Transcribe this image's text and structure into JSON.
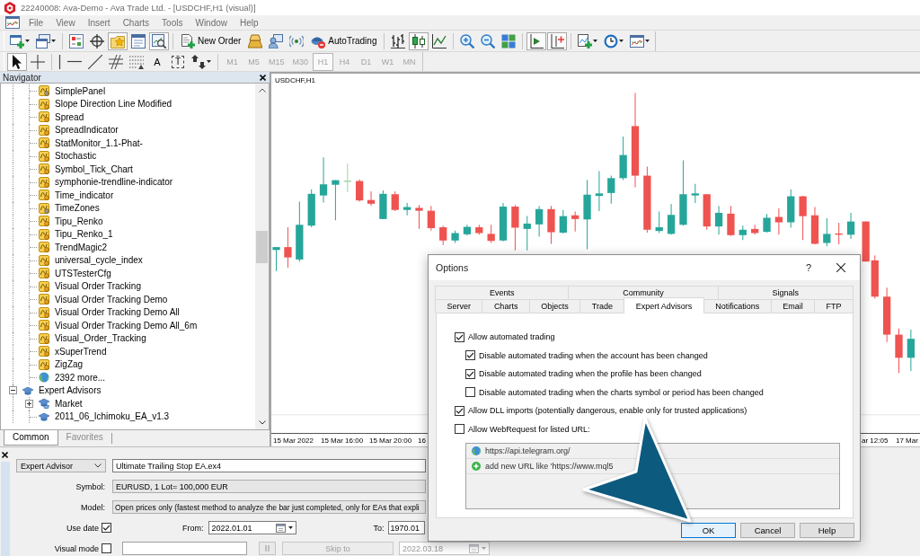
{
  "title_bar": {
    "title": "22240008: Ava-Demo - Ava Trade Ltd. - [USDCHF,H1 (visual)]"
  },
  "menu": [
    "File",
    "View",
    "Insert",
    "Charts",
    "Tools",
    "Window",
    "Help"
  ],
  "toolbar": [
    {
      "pressed": false
    },
    {
      "pressed": false
    },
    {
      "pressed": false
    },
    {
      "pressed": false
    },
    {
      "pressed": true
    },
    {
      "pressed": false
    },
    {
      "pressed": true
    },
    {
      "label": "New Order",
      "pressed": false
    },
    {
      "pressed": false
    },
    {
      "pressed": false
    },
    {
      "pressed": false
    },
    {
      "label": "AutoTrading",
      "pressed": false
    },
    {
      "pressed": false
    },
    {
      "pressed": true
    },
    {
      "pressed": false
    },
    {
      "pressed": false
    },
    {
      "pressed": false
    },
    {
      "pressed": false
    },
    {
      "pressed": true
    },
    {
      "pressed": true
    },
    {
      "pressed": false
    },
    {
      "pressed": false
    },
    {
      "pressed": false
    }
  ],
  "drawing_toolbar": [
    {
      "pressed": true
    },
    {
      "pressed": false
    },
    {
      "pressed": false
    },
    {
      "pressed": false
    },
    {
      "pressed": false
    },
    {
      "pressed": false
    },
    {
      "pressed": false
    },
    {
      "label": "A",
      "pressed": false
    },
    {
      "label": "T",
      "pressed": false
    },
    {
      "pressed": false
    }
  ],
  "timeframes": [
    {
      "label": "M1",
      "selected": false,
      "disabled": true
    },
    {
      "label": "M5",
      "selected": false,
      "disabled": true
    },
    {
      "label": "M15",
      "selected": false,
      "disabled": true
    },
    {
      "label": "M30",
      "selected": false,
      "disabled": true
    },
    {
      "label": "H1",
      "selected": true,
      "disabled": true
    },
    {
      "label": "H4",
      "selected": false,
      "disabled": true
    },
    {
      "label": "D1",
      "selected": false,
      "disabled": true
    },
    {
      "label": "W1",
      "selected": false,
      "disabled": true
    },
    {
      "label": "MN",
      "selected": false,
      "disabled": true
    }
  ],
  "navigator": {
    "title": "Navigator",
    "tree": [
      {
        "children": [
          {
            "label": "SimplePanel",
            "kind": "indicator-grey"
          },
          {
            "label": "Slope Direction Line Modified",
            "kind": "indicator"
          },
          {
            "label": "Spread",
            "kind": "indicator"
          },
          {
            "label": "SpreadIndicator",
            "kind": "indicator"
          },
          {
            "label": "StatMonitor_1.1-Phat-",
            "kind": "indicator"
          },
          {
            "label": "Stochastic",
            "kind": "indicator"
          },
          {
            "label": "Symbol_Tick_Chart",
            "kind": "indicator"
          },
          {
            "label": "symphonie-trendline-indicator",
            "kind": "indicator"
          },
          {
            "label": "Time_indicator",
            "kind": "indicator"
          },
          {
            "label": "TimeZones",
            "kind": "indicator-grey"
          },
          {
            "label": "Tipu_Renko",
            "kind": "indicator"
          },
          {
            "label": "Tipu_Renko_1",
            "kind": "indicator"
          },
          {
            "label": "TrendMagic2",
            "kind": "indicator"
          },
          {
            "label": "universal_cycle_index",
            "kind": "indicator"
          },
          {
            "label": "UTSTesterCfg",
            "kind": "indicator"
          },
          {
            "label": "Visual Order Tracking",
            "kind": "indicator"
          },
          {
            "label": "Visual Order Tracking Demo",
            "kind": "indicator"
          },
          {
            "label": "Visual Order Tracking Demo All",
            "kind": "indicator"
          },
          {
            "label": "Visual Order Tracking Demo All_6m",
            "kind": "indicator"
          },
          {
            "label": "Visual_Order_Tracking",
            "kind": "indicator"
          },
          {
            "label": "xSuperTrend",
            "kind": "indicator"
          },
          {
            "label": "ZigZag",
            "kind": "indicator"
          },
          {
            "label": "2392 more...",
            "kind": "more"
          }
        ]
      },
      {
        "label": "Expert Advisors",
        "kind": "folder",
        "expanded": true,
        "children": [
          {
            "label": "Market",
            "kind": "market",
            "expanded": false
          },
          {
            "label": "2011_06_Ichimoku_EA_v1.3",
            "kind": "expert"
          }
        ]
      }
    ],
    "tabs": [
      {
        "label": "Common",
        "selected": true
      },
      {
        "label": "Favorites",
        "selected": false
      }
    ]
  },
  "chart": {
    "title": "USDCHF,H1",
    "axis_labels": [
      "15 Mar 2022",
      "15 Mar 16:00",
      "15 Mar 20:00",
      "16",
      "ar 12:05",
      "17 Mar"
    ]
  },
  "tester": {
    "type_select": {
      "value": "Expert Advisor"
    },
    "expert_field": {
      "value": "Ultimate Trailing Stop EA.ex4"
    },
    "symbol": {
      "label": "Symbol:",
      "value": "EURUSD, 1 Lot= 100,000 EUR"
    },
    "model": {
      "label": "Model:",
      "value": "Open prices only (fastest method to analyze the bar just completed, only for EAs that expli"
    },
    "use_date": {
      "label": "Use date",
      "checked": true
    },
    "from": {
      "label": "From:",
      "value": "2022.01.01"
    },
    "to": {
      "label": "To:",
      "value": "1970.01"
    },
    "visual_mode": {
      "label": "Visual mode",
      "checked": false
    },
    "pause_button": {
      "disabled": true
    },
    "skip_button": {
      "label": "Skip to",
      "disabled": true
    },
    "skip_date": {
      "value": "2022.03.18",
      "disabled": true
    }
  },
  "options_dialog": {
    "title": "Options",
    "help": "?",
    "tab_rows": [
      [
        {
          "label": "Events",
          "selected": false
        },
        {
          "label": "Community",
          "selected": false
        },
        {
          "label": "Signals",
          "selected": false
        }
      ],
      [
        {
          "label": "Server",
          "selected": false
        },
        {
          "label": "Charts",
          "selected": false
        },
        {
          "label": "Objects",
          "selected": false
        },
        {
          "label": "Trade",
          "selected": false
        },
        {
          "label": "Expert Advisors",
          "selected": true
        },
        {
          "label": "Notifications",
          "selected": false
        },
        {
          "label": "Email",
          "selected": false
        },
        {
          "label": "FTP",
          "selected": false
        }
      ]
    ],
    "options": [
      {
        "label": "Allow automated trading",
        "checked": true,
        "children": [
          {
            "label": "Disable automated trading when the account has been changed",
            "checked": true
          },
          {
            "label": "Disable automated trading when the profile has been changed",
            "checked": true
          },
          {
            "label": "Disable automated trading when the charts symbol or period has been changed",
            "checked": false
          }
        ]
      },
      {
        "label": "Allow DLL imports (potentially dangerous, enable only for trusted applications)",
        "checked": true
      },
      {
        "label": "Allow WebRequest for listed URL:",
        "checked": false
      }
    ],
    "url_list": [
      {
        "kind": "url",
        "text": "https://api.telegram.org/"
      },
      {
        "kind": "add",
        "text": "add new URL like 'https://www.mql5"
      }
    ],
    "buttons": [
      {
        "label": "OK",
        "default": true
      },
      {
        "label": "Cancel",
        "default": false
      },
      {
        "label": "Help",
        "default": false
      }
    ]
  }
}
